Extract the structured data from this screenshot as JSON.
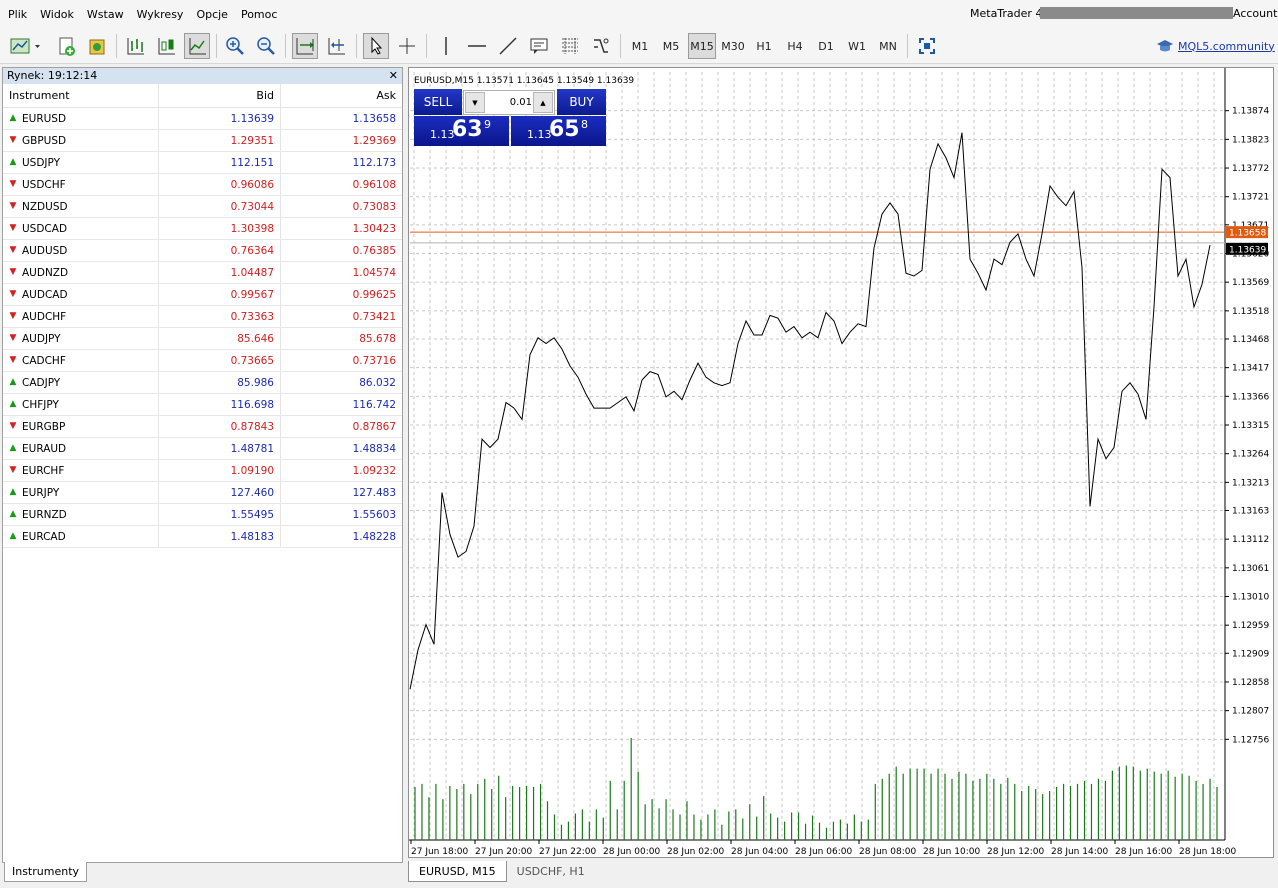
{
  "menu": [
    "Plik",
    "Widok",
    "Wstaw",
    "Wykresy",
    "Opcje",
    "Pomoc"
  ],
  "window": {
    "title_prefix": "MetaTrader 4 -",
    "title_suffix": "Account"
  },
  "toolbar": {
    "timeframes": [
      "M1",
      "M5",
      "M15",
      "M30",
      "H1",
      "H4",
      "D1",
      "W1",
      "MN"
    ],
    "active_timeframe": "M15",
    "mql5_link": "MQL5.community",
    "icons": [
      "new-chart-icon",
      "profiles-icon",
      "open-data-window-icon",
      "market-watch-icon",
      "bar-chart-icon",
      "candlestick-icon",
      "line-chart-icon",
      "zoom-in-icon",
      "zoom-out-icon",
      "auto-scroll-icon",
      "chart-shift-icon",
      "cursor-icon",
      "crosshair-icon",
      "vertical-line-icon",
      "horizontal-line-icon",
      "trendline-icon",
      "text-label-icon",
      "fibonacci-icon",
      "indicators-icon",
      "fullscreen-icon"
    ]
  },
  "market_watch": {
    "title": "Rynek: 19:12:14",
    "columns": {
      "instrument": "Instrument",
      "bid": "Bid",
      "ask": "Ask"
    },
    "rows": [
      {
        "symbol": "EURUSD",
        "bid": "1.13639",
        "ask": "1.13658",
        "dir": "up"
      },
      {
        "symbol": "GBPUSD",
        "bid": "1.29351",
        "ask": "1.29369",
        "dir": "down"
      },
      {
        "symbol": "USDJPY",
        "bid": "112.151",
        "ask": "112.173",
        "dir": "up"
      },
      {
        "symbol": "USDCHF",
        "bid": "0.96086",
        "ask": "0.96108",
        "dir": "down"
      },
      {
        "symbol": "NZDUSD",
        "bid": "0.73044",
        "ask": "0.73083",
        "dir": "down"
      },
      {
        "symbol": "USDCAD",
        "bid": "1.30398",
        "ask": "1.30423",
        "dir": "down"
      },
      {
        "symbol": "AUDUSD",
        "bid": "0.76364",
        "ask": "0.76385",
        "dir": "down"
      },
      {
        "symbol": "AUDNZD",
        "bid": "1.04487",
        "ask": "1.04574",
        "dir": "down"
      },
      {
        "symbol": "AUDCAD",
        "bid": "0.99567",
        "ask": "0.99625",
        "dir": "down"
      },
      {
        "symbol": "AUDCHF",
        "bid": "0.73363",
        "ask": "0.73421",
        "dir": "down"
      },
      {
        "symbol": "AUDJPY",
        "bid": "85.646",
        "ask": "85.678",
        "dir": "down"
      },
      {
        "symbol": "CADCHF",
        "bid": "0.73665",
        "ask": "0.73716",
        "dir": "down"
      },
      {
        "symbol": "CADJPY",
        "bid": "85.986",
        "ask": "86.032",
        "dir": "up"
      },
      {
        "symbol": "CHFJPY",
        "bid": "116.698",
        "ask": "116.742",
        "dir": "up"
      },
      {
        "symbol": "EURGBP",
        "bid": "0.87843",
        "ask": "0.87867",
        "dir": "down"
      },
      {
        "symbol": "EURAUD",
        "bid": "1.48781",
        "ask": "1.48834",
        "dir": "up"
      },
      {
        "symbol": "EURCHF",
        "bid": "1.09190",
        "ask": "1.09232",
        "dir": "down"
      },
      {
        "symbol": "EURJPY",
        "bid": "127.460",
        "ask": "127.483",
        "dir": "up"
      },
      {
        "symbol": "EURNZD",
        "bid": "1.55495",
        "ask": "1.55603",
        "dir": "up"
      },
      {
        "symbol": "EURCAD",
        "bid": "1.48183",
        "ask": "1.48228",
        "dir": "up"
      }
    ],
    "bottom_tab": "Instrumenty"
  },
  "trade_panel": {
    "sell_label": "SELL",
    "buy_label": "BUY",
    "lot": "0.01",
    "sell_prefix": "1.13",
    "sell_big": "63",
    "sell_sup": "9",
    "buy_prefix": "1.13",
    "buy_big": "65",
    "buy_sup": "8"
  },
  "chart_tabs": [
    "EURUSD, M15",
    "USDCHF, H1"
  ],
  "chart_data": {
    "type": "line",
    "title": "EURUSD,M15  1.13571 1.13645 1.13549 1.13639",
    "symbol": "EURUSD",
    "timeframe": "M15",
    "ylim": [
      1.12705,
      1.13925
    ],
    "yticks": [
      "1.13874",
      "1.13823",
      "1.13772",
      "1.13721",
      "1.13671",
      "1.13620",
      "1.13569",
      "1.13518",
      "1.13468",
      "1.13417",
      "1.13366",
      "1.13315",
      "1.13264",
      "1.13213",
      "1.13163",
      "1.13112",
      "1.13061",
      "1.13010",
      "1.12959",
      "1.12909",
      "1.12858",
      "1.12807",
      "1.12756"
    ],
    "xticks": [
      "27 Jun 18:00",
      "27 Jun 20:00",
      "27 Jun 22:00",
      "28 Jun 00:00",
      "28 Jun 02:00",
      "28 Jun 04:00",
      "28 Jun 06:00",
      "28 Jun 08:00",
      "28 Jun 10:00",
      "28 Jun 12:00",
      "28 Jun 14:00",
      "28 Jun 16:00",
      "28 Jun 18:00"
    ],
    "ask_line": {
      "value": 1.13658,
      "label": "1.13658",
      "color": "#e05a10"
    },
    "bid_line": {
      "value": 1.13639,
      "label": "1.13639",
      "color": "#000000"
    },
    "values": [
      1.12845,
      1.12915,
      1.1296,
      1.12925,
      1.13195,
      1.1312,
      1.1308,
      1.1309,
      1.13135,
      1.1329,
      1.13275,
      1.1329,
      1.13355,
      1.13345,
      1.13325,
      1.1344,
      1.1347,
      1.1346,
      1.1347,
      1.1345,
      1.1342,
      1.134,
      1.1337,
      1.13345,
      1.13345,
      1.13345,
      1.13355,
      1.13365,
      1.1334,
      1.13395,
      1.1341,
      1.13405,
      1.13365,
      1.13375,
      1.1336,
      1.13395,
      1.13425,
      1.134,
      1.1339,
      1.13385,
      1.1339,
      1.1346,
      1.135,
      1.13475,
      1.13475,
      1.1351,
      1.13505,
      1.1348,
      1.1349,
      1.1347,
      1.1348,
      1.1347,
      1.13515,
      1.135,
      1.1346,
      1.1348,
      1.13495,
      1.1349,
      1.1363,
      1.1369,
      1.1371,
      1.1369,
      1.13585,
      1.1358,
      1.1359,
      1.1377,
      1.13815,
      1.1379,
      1.13755,
      1.13835,
      1.1361,
      1.13585,
      1.13555,
      1.1361,
      1.136,
      1.1364,
      1.13655,
      1.1361,
      1.1358,
      1.13655,
      1.1374,
      1.1372,
      1.13705,
      1.1373,
      1.13595,
      1.1317,
      1.1329,
      1.13255,
      1.13275,
      1.13375,
      1.1339,
      1.1337,
      1.13325,
      1.13525,
      1.1377,
      1.13755,
      1.1358,
      1.1361,
      1.13525,
      1.13565,
      1.13635
    ],
    "volume": [
      0.52,
      0.55,
      0.42,
      0.55,
      0.4,
      0.53,
      0.5,
      0.55,
      0.45,
      0.55,
      0.6,
      0.5,
      0.63,
      0.42,
      0.53,
      0.52,
      0.53,
      0.52,
      0.55,
      0.38,
      0.25,
      0.15,
      0.18,
      0.26,
      0.3,
      0.18,
      0.3,
      0.22,
      0.58,
      0.3,
      0.58,
      1.0,
      0.67,
      0.35,
      0.4,
      0.31,
      0.4,
      0.3,
      0.25,
      0.38,
      0.25,
      0.2,
      0.25,
      0.3,
      0.15,
      0.28,
      0.3,
      0.21,
      0.35,
      0.23,
      0.43,
      0.26,
      0.22,
      0.18,
      0.27,
      0.27,
      0.16,
      0.24,
      0.17,
      0.12,
      0.18,
      0.2,
      0.16,
      0.25,
      0.18,
      0.2,
      0.55,
      0.6,
      0.65,
      0.72,
      0.65,
      0.7,
      0.7,
      0.7,
      0.65,
      0.7,
      0.65,
      0.6,
      0.67,
      0.65,
      0.58,
      0.6,
      0.65,
      0.6,
      0.55,
      0.61,
      0.55,
      0.48,
      0.53,
      0.5,
      0.45,
      0.48,
      0.52,
      0.55,
      0.53,
      0.55,
      0.58,
      0.55,
      0.6,
      0.58,
      0.68,
      0.72,
      0.73,
      0.72,
      0.68,
      0.7,
      0.67,
      0.65,
      0.68,
      0.62,
      0.65,
      0.63,
      0.58,
      0.55,
      0.6,
      0.52
    ],
    "grid": true,
    "line_color": "#000000",
    "volume_color": "#1a7a1a"
  }
}
